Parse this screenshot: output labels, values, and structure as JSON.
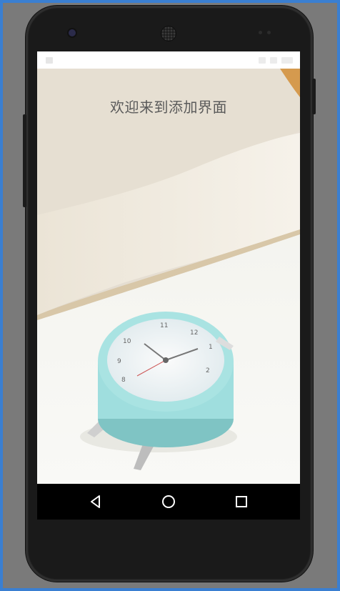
{
  "app": {
    "welcome_text": "欢迎来到添加界面"
  },
  "status_bar": {
    "left_icon": "notification-icon",
    "right_icons": [
      "signal-icon",
      "battery-icon",
      "time-placeholder"
    ]
  },
  "nav_bar": {
    "back": "back-icon",
    "home": "home-icon",
    "recents": "recents-icon"
  },
  "colors": {
    "frame_background": "#3a7fd1",
    "device_body": "#222222",
    "status_bar": "#ffffff",
    "nav_bar": "#000000",
    "welcome_text": "#5a5a5a",
    "clock_body": "#9fdede"
  }
}
